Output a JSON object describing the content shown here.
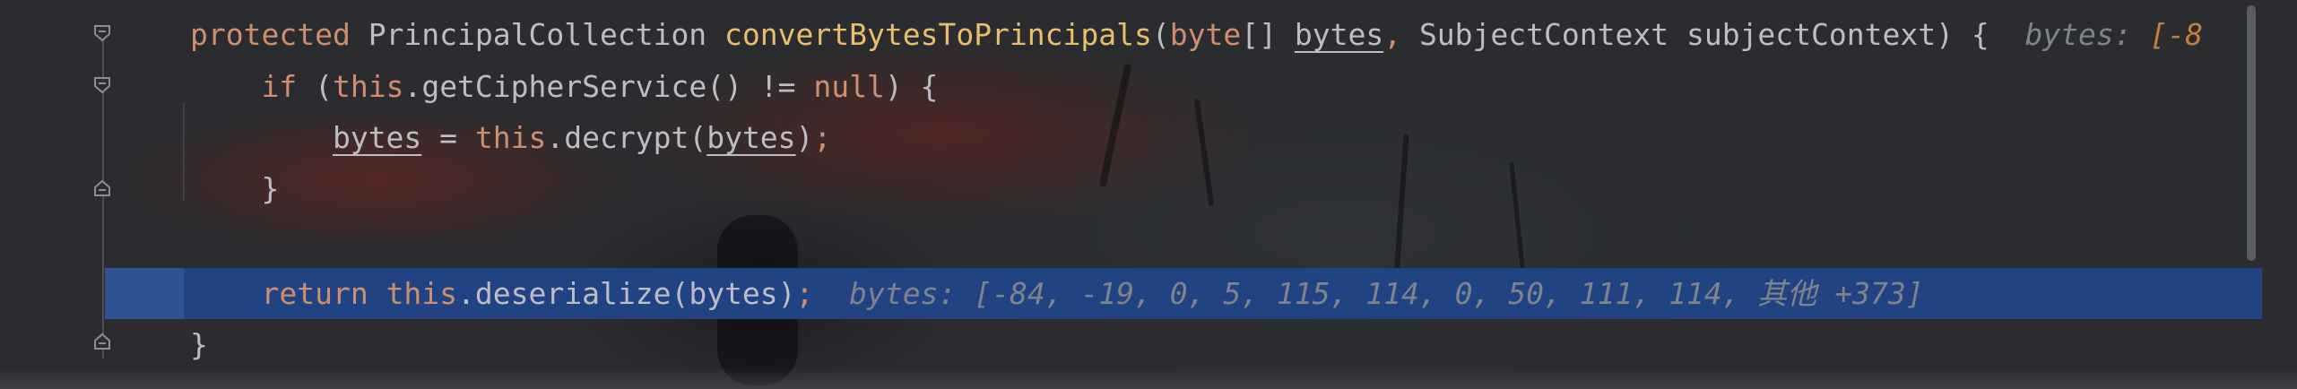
{
  "editor": {
    "lines": [
      {
        "tokens": [
          {
            "cls": "kw",
            "text": "protected "
          },
          {
            "cls": "plain",
            "text": "PrincipalCollection "
          },
          {
            "cls": "fn",
            "text": "convertBytesToPrincipals"
          },
          {
            "cls": "plain",
            "text": "("
          },
          {
            "cls": "kw",
            "text": "byte"
          },
          {
            "cls": "plain",
            "text": "[] "
          },
          {
            "cls": "under",
            "text": "bytes"
          },
          {
            "cls": "semi",
            "text": ", "
          },
          {
            "cls": "plain",
            "text": "SubjectContext subjectContext) {  "
          },
          {
            "cls": "hint",
            "text": "bytes: "
          },
          {
            "cls": "hint-accent",
            "text": "[-8"
          }
        ]
      },
      {
        "tokens": [
          {
            "cls": "plain",
            "text": "    "
          },
          {
            "cls": "kw",
            "text": "if "
          },
          {
            "cls": "plain",
            "text": "("
          },
          {
            "cls": "kw",
            "text": "this"
          },
          {
            "cls": "plain",
            "text": ".getCipherService() != "
          },
          {
            "cls": "kw",
            "text": "null"
          },
          {
            "cls": "plain",
            "text": ") {"
          }
        ]
      },
      {
        "tokens": [
          {
            "cls": "plain",
            "text": "        "
          },
          {
            "cls": "under",
            "text": "bytes"
          },
          {
            "cls": "plain",
            "text": " = "
          },
          {
            "cls": "kw",
            "text": "this"
          },
          {
            "cls": "plain",
            "text": ".decrypt("
          },
          {
            "cls": "under",
            "text": "bytes"
          },
          {
            "cls": "plain",
            "text": ")"
          },
          {
            "cls": "semi",
            "text": ";"
          }
        ]
      },
      {
        "tokens": [
          {
            "cls": "plain",
            "text": "    }"
          }
        ]
      },
      {
        "tokens": []
      },
      {
        "tokens": [
          {
            "cls": "plain",
            "text": "    "
          },
          {
            "cls": "kw",
            "text": "return "
          },
          {
            "cls": "kw",
            "text": "this"
          },
          {
            "cls": "plain",
            "text": ".deserialize(bytes)"
          },
          {
            "cls": "semi",
            "text": ";  "
          },
          {
            "cls": "hint",
            "text": "bytes: [-84, -19, 0, 5, 115, 114, 0, 50, 111, 114, 其他 +373]"
          }
        ]
      },
      {
        "tokens": [
          {
            "cls": "plain",
            "text": "}"
          }
        ]
      }
    ],
    "colors": {
      "keyword": "#cf8e6d",
      "function": "#e8bf6a",
      "text": "#bcbec4",
      "hint": "#7f838a",
      "execution_line": "#214283"
    },
    "icons": [
      "fold-open-icon",
      "fold-open-icon",
      "fold-close-icon",
      "fold-close-icon"
    ]
  }
}
